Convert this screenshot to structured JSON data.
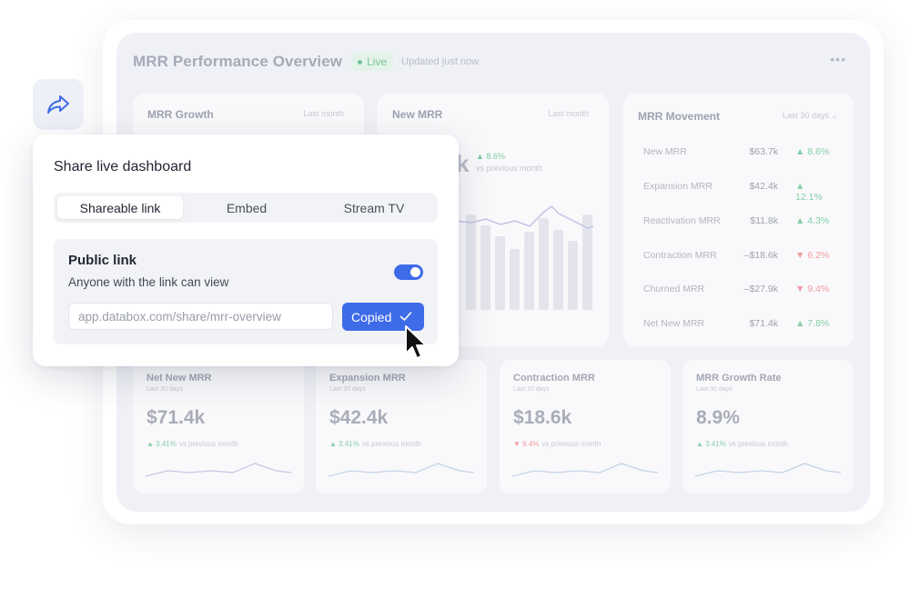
{
  "dashboard": {
    "title": "MRR Performance Overview",
    "live_label": "Live",
    "updated": "Updated just now",
    "more_icon": "more-horizontal-icon",
    "cards": {
      "mrr_growth": {
        "title": "MRR Growth",
        "period": "Last month"
      },
      "new_mrr": {
        "title": "New MRR",
        "period": "Last month",
        "value_visible": "k",
        "delta": "▲ 8.6%",
        "vs": "vs previous month"
      },
      "movement": {
        "title": "MRR Movement",
        "period": "Last 30 days ⌄",
        "rows": [
          {
            "name": "New MRR",
            "value": "$63.7k",
            "change": "▲ 8.6%",
            "trend": "up"
          },
          {
            "name": "Expansion MRR",
            "value": "$42.4k",
            "change": "▲ 12.1%",
            "trend": "up"
          },
          {
            "name": "Reactivation MRR",
            "value": "$11.8k",
            "change": "▲ 4.3%",
            "trend": "up"
          },
          {
            "name": "Contraction MRR",
            "value": "–$18.6k",
            "change": "▼ 6.2%",
            "trend": "down"
          },
          {
            "name": "Churned MRR",
            "value": "–$27.9k",
            "change": "▼ 9.4%",
            "trend": "down"
          },
          {
            "name": "Net New MRR",
            "value": "$71.4k",
            "change": "▲ 7.8%",
            "trend": "up"
          }
        ]
      }
    },
    "kpis": [
      {
        "title": "Net New MRR",
        "period": "Last 30 days",
        "value": "$71.4k",
        "change": "▲ 3.41%",
        "trend": "up",
        "vs": "vs previous month"
      },
      {
        "title": "Expansion MRR",
        "period": "Last 30 days",
        "value": "$42.4k",
        "change": "▲ 3.41%",
        "trend": "up",
        "vs": "vs previous month"
      },
      {
        "title": "Contraction MRR",
        "period": "Last 30 days",
        "value": "$18.6k",
        "change": "▼ 9.4%",
        "trend": "down",
        "vs": "vs previous month"
      },
      {
        "title": "MRR Growth Rate",
        "period": "Last 30 days",
        "value": "8.9%",
        "change": "▲ 3.41%",
        "trend": "up",
        "vs": "vs previous month"
      }
    ]
  },
  "share_icon": "share-forward-icon",
  "modal": {
    "title": "Share live dashboard",
    "tabs": [
      "Shareable link",
      "Embed",
      "Stream TV"
    ],
    "active_tab": "Shareable link",
    "panel": {
      "title": "Public link",
      "description": "Anyone with the link can view",
      "toggle_on": true,
      "url": "app.databox.com/share/mrr-overview",
      "button_label": "Copied"
    }
  },
  "colors": {
    "accent": "#3e6be8",
    "positive": "#86cfa6",
    "negative": "#f19aa0",
    "live": "#74c596"
  }
}
